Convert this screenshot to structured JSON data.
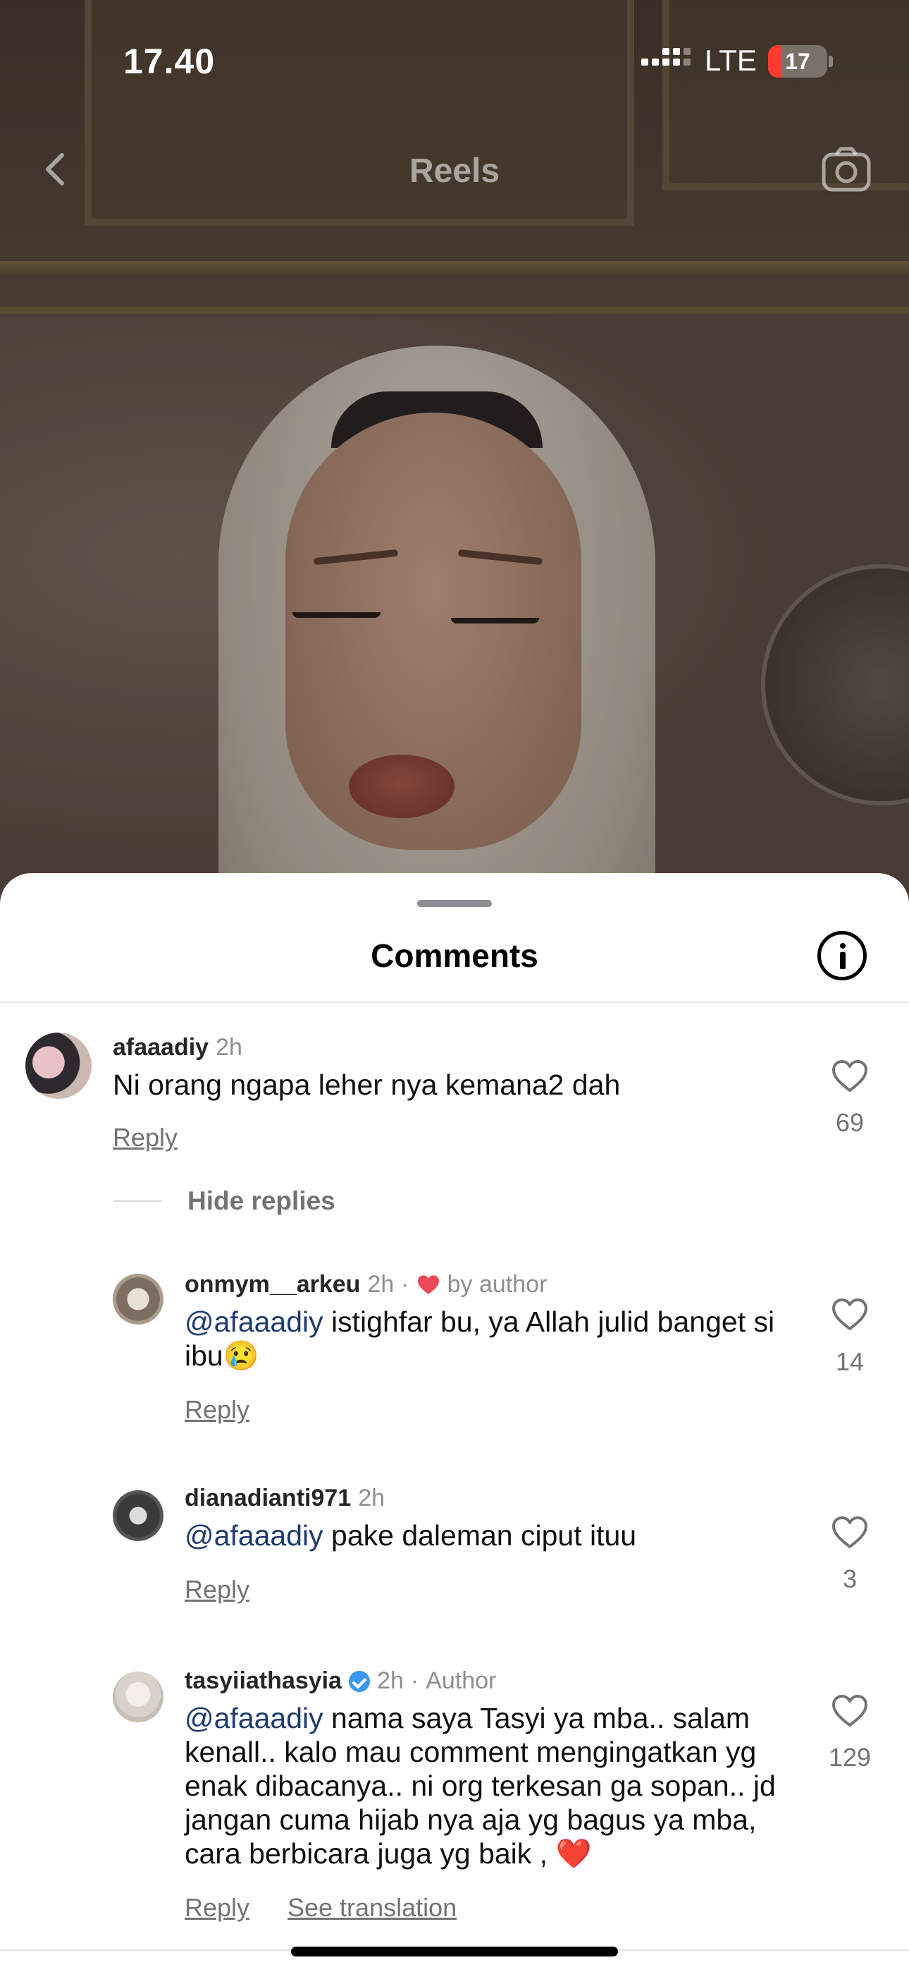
{
  "status_bar": {
    "time": "17.40",
    "network": "LTE",
    "battery": "17"
  },
  "nav": {
    "title": "Reels"
  },
  "sheet": {
    "title": "Comments"
  },
  "comments": [
    {
      "username": "afaaadiy",
      "time": "2h",
      "text": "Ni orang ngapa leher nya kemana2 dah",
      "reply": "Reply",
      "likes": "69"
    }
  ],
  "hide_replies": "Hide replies",
  "replies": [
    {
      "username": "onmym__arkeu",
      "time": "2h",
      "separator": "·",
      "badge": "by author",
      "mention": "@afaaadiy",
      "text": " istighfar bu, ya Allah julid banget si ibu",
      "emoji": "😢",
      "reply": "Reply",
      "likes": "14"
    },
    {
      "username": "dianadianti971",
      "time": "2h",
      "mention": "@afaaadiy",
      "text": " pake daleman ciput ituu",
      "reply": "Reply",
      "likes": "3"
    },
    {
      "username": "tasyiiathasyia",
      "time": "2h",
      "separator": "·",
      "badge": "Author",
      "mention": "@afaaadiy",
      "text": " nama saya Tasyi ya mba.. salam kenall.. kalo mau comment mengingatkan yg enak dibacanya.. ni org terkesan ga sopan.. jd jangan cuma hijab nya aja yg bagus ya mba, cara berbicara juga yg baik , ",
      "emoji": "❤️",
      "reply": "Reply",
      "see_translation": "See translation",
      "likes": "129"
    }
  ],
  "icons": {
    "back": "chevron-left-icon",
    "camera": "camera-icon",
    "info": "info-icon",
    "like": "heart-outline-icon",
    "liked_by_author": "heart-filled-icon",
    "verified": "verified-badge-icon"
  },
  "colors": {
    "mention": "#1f3a6e",
    "verified": "#3897f0",
    "heart_red": "#ed4956",
    "battery_low": "#ff3b30"
  }
}
